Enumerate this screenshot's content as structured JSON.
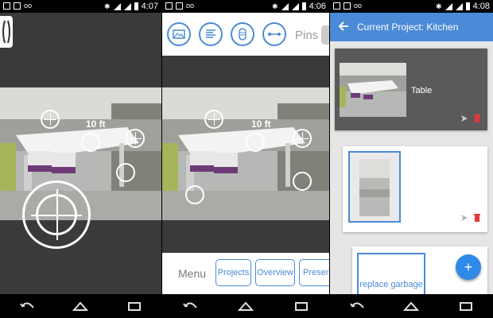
{
  "status": {
    "time_left": "4:07",
    "time_middle": "4:06",
    "time_right": "4:08"
  },
  "screen1": {
    "distance_label": "10 ft",
    "side_handle_icon": "bracket-handle-icon"
  },
  "screen2": {
    "toolbar_icons": [
      "image-icon",
      "list-icon",
      "pill-icon",
      "measure-icon"
    ],
    "pins_label": "Pins",
    "distance_label": "10 ft",
    "menu_label": "Menu",
    "tabs": [
      "Projects",
      "Overview",
      "Presen"
    ]
  },
  "screen3": {
    "title": "Current Project: Kitchen",
    "cards": [
      {
        "caption": "Table"
      },
      {
        "caption": ""
      }
    ],
    "partial_card_text": "replace garbage",
    "fab_label": "+"
  },
  "colors": {
    "accent": "#4b8ad6",
    "delete": "#e53935",
    "fab": "#2e8ae6"
  }
}
